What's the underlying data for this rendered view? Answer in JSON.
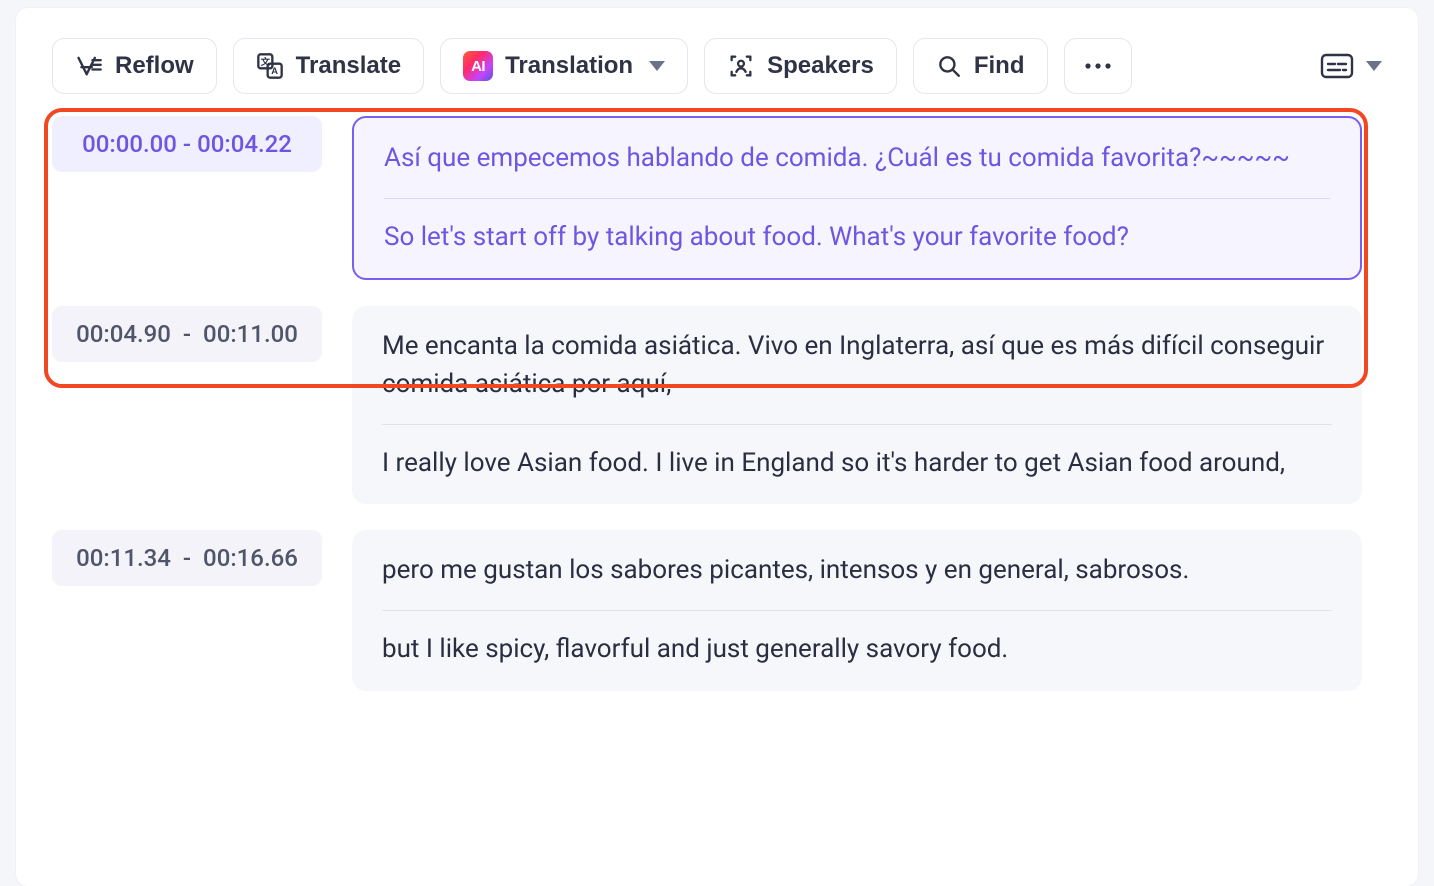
{
  "toolbar": {
    "reflow": "Reflow",
    "translate": "Translate",
    "translation": "Translation",
    "speakers": "Speakers",
    "find": "Find"
  },
  "segments": [
    {
      "start": "00:00.00",
      "end": "00:04.22",
      "active": true,
      "primary": "Así que empecemos hablando de comida. ¿Cuál es tu comida favorita?~~~~~",
      "secondary": "So let's start off by talking about food. What's your favorite food?"
    },
    {
      "start": "00:04.90",
      "end": "00:11.00",
      "active": false,
      "primary": "Me encanta la comida asiática. Vivo en Inglaterra, así que es más difícil conseguir comida asiática por aquí,",
      "secondary": "I really love Asian food. I live in England so it's harder to get Asian food around,"
    },
    {
      "start": "00:11.34",
      "end": "00:16.66",
      "active": false,
      "primary": "pero me gustan los sabores picantes, intensos y en general, sabrosos.",
      "secondary": "but I like spicy, flavorful and just generally savory food."
    }
  ]
}
